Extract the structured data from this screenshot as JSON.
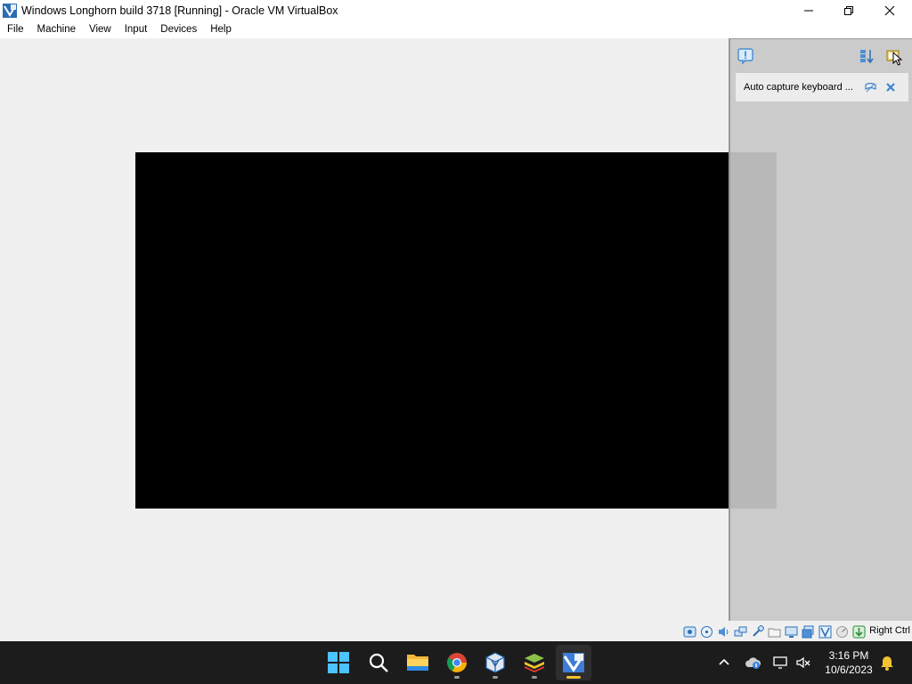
{
  "window": {
    "title": "Windows Longhorn build 3718 [Running] - Oracle VM VirtualBox",
    "app_icon": "virtualbox-icon"
  },
  "menu": {
    "items": [
      {
        "label": "File"
      },
      {
        "label": "Machine"
      },
      {
        "label": "View"
      },
      {
        "label": "Input"
      },
      {
        "label": "Devices"
      },
      {
        "label": "Help"
      }
    ]
  },
  "notification_panel": {
    "message": "Auto capture keyboard ..."
  },
  "statusbar": {
    "host_key": "Right Ctrl",
    "icons": [
      "hard-disk-icon",
      "optical-drive-icon",
      "audio-icon",
      "network-icon",
      "usb-icon",
      "shared-folders-icon",
      "display-icon",
      "recording-icon",
      "cpu-icon",
      "mouse-integration-icon",
      "host-key-icon"
    ]
  },
  "taskbar": {
    "apps": [
      "start-icon",
      "search-icon",
      "file-explorer-icon",
      "chrome-icon",
      "virtualbox-manager-icon",
      "bluestacks-icon",
      "virtualbox-vm-icon"
    ],
    "clock": {
      "time": "3:16 PM",
      "date": "10/6/2023"
    }
  },
  "colors": {
    "taskbar": "#1c1c1c",
    "vm_background": "#000000",
    "panel": "#c8c8c8",
    "active_indicator": "#f1c232"
  }
}
